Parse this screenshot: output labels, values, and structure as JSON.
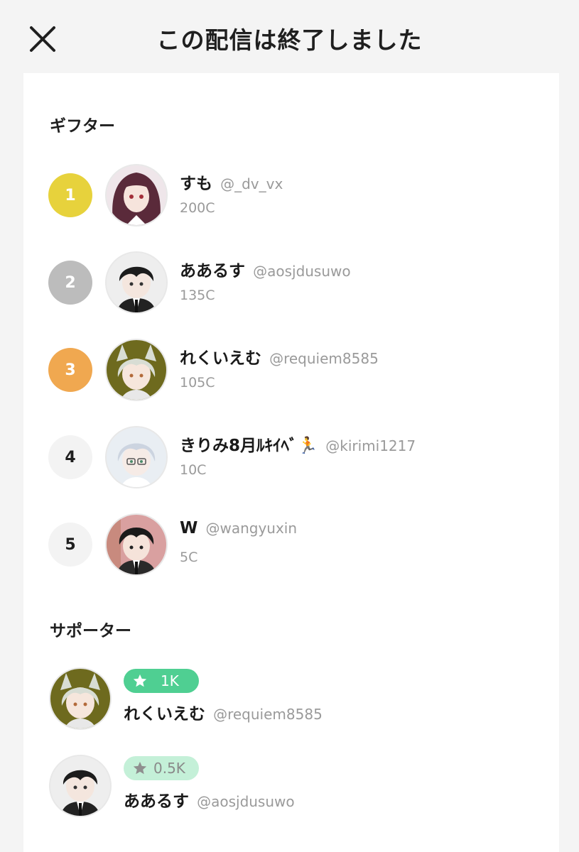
{
  "header": {
    "title": "この配信は終了しました"
  },
  "gifters": {
    "title": "ギフター",
    "items": [
      {
        "rank": "1",
        "name": "すも",
        "handle": "@_dv_vx",
        "coins": "200C"
      },
      {
        "rank": "2",
        "name": "ああるす",
        "handle": "@aosjdusuwo",
        "coins": "135C"
      },
      {
        "rank": "3",
        "name": "れくいえむ",
        "handle": "@requiem8585",
        "coins": "105C"
      },
      {
        "rank": "4",
        "name": "きりみ8月ﾙｷｲﾍﾞ🏃",
        "handle": "@kirimi1217",
        "coins": "10C"
      },
      {
        "rank": "5",
        "name": "W",
        "handle": "@wangyuxin",
        "coins": "5C"
      }
    ]
  },
  "supporters": {
    "title": "サポーター",
    "items": [
      {
        "badge": "1K",
        "name": "れくいえむ",
        "handle": "@requiem8585"
      },
      {
        "badge": "0.5K",
        "name": "ああるす",
        "handle": "@aosjdusuwo"
      }
    ]
  },
  "icons": [
    "close-icon",
    "star-icon"
  ],
  "colors": {
    "rank_gold": "#e7d23c",
    "rank_silver": "#bcbcbc",
    "rank_bronze": "#f0a850",
    "badge_green": "#4fcf92",
    "badge_light_green": "#c4f0d8"
  }
}
